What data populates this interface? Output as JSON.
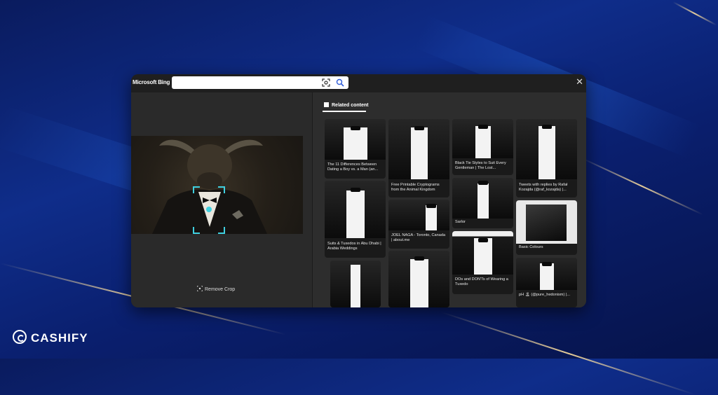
{
  "window": {
    "brand": "Microsoft Bing",
    "search_placeholder": "",
    "close_glyph": "✕"
  },
  "left_panel": {
    "remove_crop_label": "Remove Crop"
  },
  "related": {
    "heading": "Related content",
    "results": [
      {
        "caption": "The 11 Differences Between Dating a Boy vs. a Man (an..."
      },
      {
        "caption": "Free Printable Cryptograms from the Animal Kingdom"
      },
      {
        "caption": "Black Tie Styles to Suit Every Gentleman | The Lost..."
      },
      {
        "caption": "Tweets with replies by Rafał Kozajda (@raf_kozajda) |..."
      },
      {
        "caption": "Suits & Tuxedos in Abu Dhabi | Arabia Weddings"
      },
      {
        "caption": "JOEL NAGA - Toronto, Canada | about.me"
      },
      {
        "caption": "Sarlor"
      },
      {
        "caption": "Basic Colours"
      },
      {
        "caption": "DOs and DON'Ts of Wearing a Tuxedo"
      },
      {
        "caption": "pH 🏝 (@pure_hedonism) |..."
      }
    ]
  },
  "watermark": {
    "brand": "CASHIFY"
  },
  "colors": {
    "background": "#0f2d8a",
    "window": "#2b2b2b",
    "crop_accent": "#3fd0e0"
  }
}
